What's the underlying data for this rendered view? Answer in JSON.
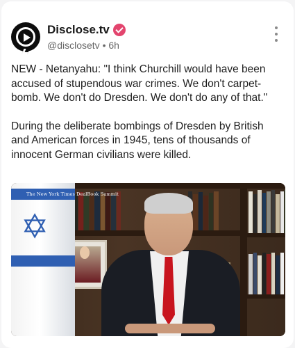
{
  "post": {
    "author": {
      "display_name": "Disclose.tv",
      "handle": "@disclosetv",
      "separator": "•",
      "time_ago": "6h"
    },
    "text": {
      "paragraph_1": "NEW - Netanyahu: \"I think Churchill would have been accused of stupendous war crimes. We don't carpet-bomb. We don't do Dresden. We don't do any of that.\"",
      "paragraph_2": "During the deliberate bombings of Dresden by British and American forces in 1945, tens of thousands of innocent German civilians were killed."
    },
    "media": {
      "watermark": "The New York Times DealBook Summit"
    }
  },
  "colors": {
    "verified_badge": "#e3456e",
    "avatar_bg": "#0d0d0d",
    "flag_blue": "#2f5fb2",
    "tie_red": "#c8141e"
  },
  "icons": {
    "avatar": "play-logo-icon",
    "verified": "verified-badge-icon",
    "menu": "more-vertical-icon"
  }
}
